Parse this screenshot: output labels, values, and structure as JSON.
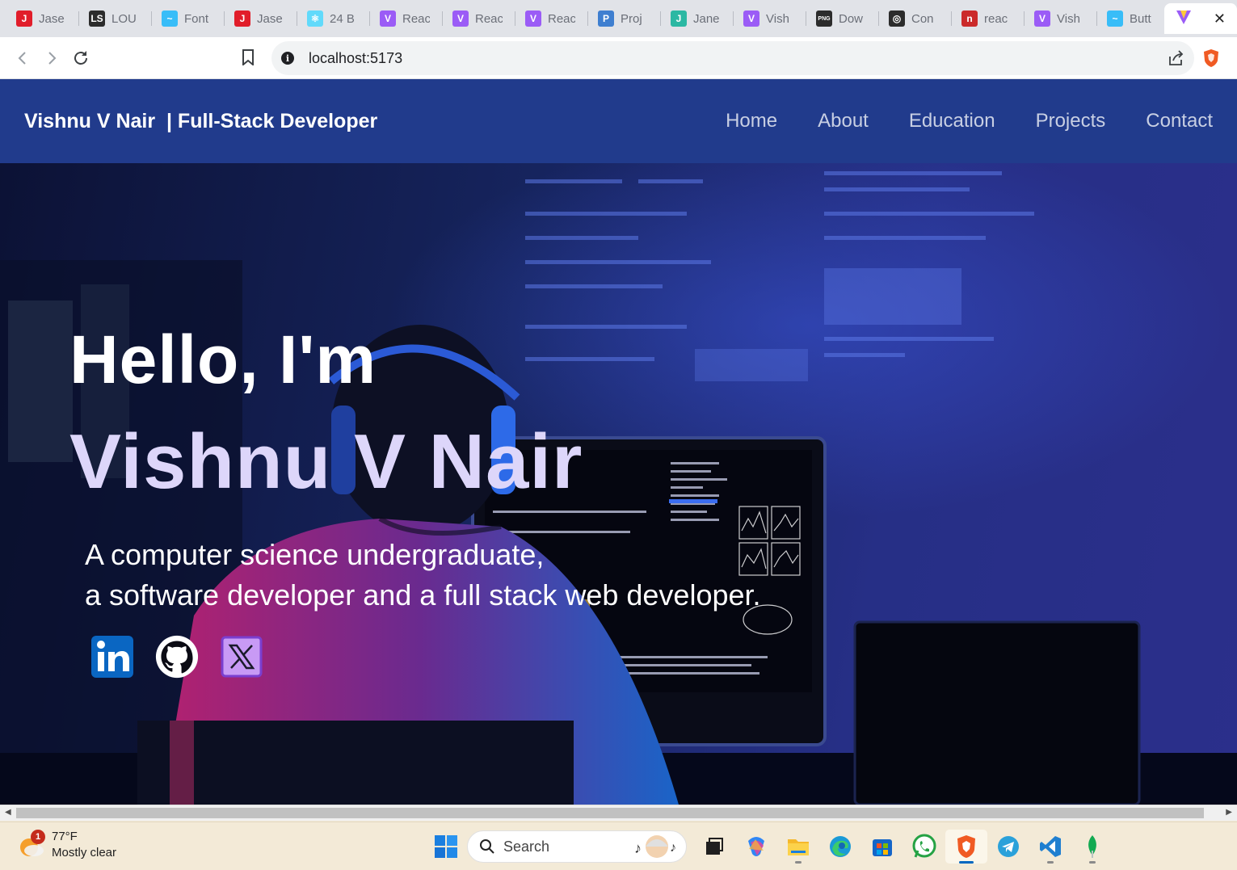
{
  "browser": {
    "tabs": [
      {
        "label": "Jase",
        "icon": "letter-j-icon",
        "color": "#e11d2a",
        "glyph": "J"
      },
      {
        "label": "LOU",
        "icon": "ls-icon",
        "color": "#2c2c2c",
        "glyph": "LS"
      },
      {
        "label": "Font",
        "icon": "tailwind-icon",
        "color": "#38bdf8",
        "glyph": "~"
      },
      {
        "label": "Jase",
        "icon": "letter-j-icon",
        "color": "#e11d2a",
        "glyph": "J"
      },
      {
        "label": "24 B",
        "icon": "react-icon",
        "color": "#61dafb",
        "glyph": "⚛"
      },
      {
        "label": "Reac",
        "icon": "vite-icon",
        "color": "#9b5cf6",
        "glyph": "V"
      },
      {
        "label": "Reac",
        "icon": "vite-icon",
        "color": "#9b5cf6",
        "glyph": "V"
      },
      {
        "label": "Reac",
        "icon": "vite-icon",
        "color": "#9b5cf6",
        "glyph": "V"
      },
      {
        "label": "Proj",
        "icon": "project-icon",
        "color": "#3f7fd0",
        "glyph": "P"
      },
      {
        "label": "Jane",
        "icon": "jane-icon",
        "color": "#2bb8a3",
        "glyph": "J"
      },
      {
        "label": "Vish",
        "icon": "vite-icon",
        "color": "#9b5cf6",
        "glyph": "V"
      },
      {
        "label": "Dow",
        "icon": "png-icon",
        "color": "#2c2c2c",
        "glyph": "PNG"
      },
      {
        "label": "Con",
        "icon": "chatgpt-icon",
        "color": "#2c2c2c",
        "glyph": "◎"
      },
      {
        "label": "reac",
        "icon": "npm-icon",
        "color": "#cb2a2a",
        "glyph": "n"
      },
      {
        "label": "Vish",
        "icon": "vite-icon",
        "color": "#9b5cf6",
        "glyph": "V"
      },
      {
        "label": "Butt",
        "icon": "tailwind-icon",
        "color": "#38bdf8",
        "glyph": "~"
      }
    ],
    "active_tab": {
      "icon": "vite-icon",
      "close_glyph": "✕"
    },
    "url": "localhost:5173"
  },
  "site": {
    "brand": "Vishnu V Nair  | Full-Stack Developer",
    "nav": [
      "Home",
      "About",
      "Education",
      "Projects",
      "Contact"
    ],
    "hero": {
      "hello": "Hello, I'm",
      "name": "Vishnu V Nair",
      "tagline_line1": "A computer science undergraduate,",
      "tagline_line2": "a software developer and a full stack web developer."
    },
    "socials": [
      "linkedin-icon",
      "github-icon",
      "x-twitter-icon"
    ]
  },
  "taskbar": {
    "weather": {
      "temp": "77°F",
      "condition": "Mostly clear",
      "badge": "1"
    },
    "search_label": "Search",
    "apps": [
      "windows-start-icon",
      "task-view-icon",
      "copilot-icon",
      "file-explorer-icon",
      "edge-icon",
      "store-icon",
      "whatsapp-icon",
      "brave-icon",
      "telegram-icon",
      "vscode-icon",
      "mongodb-icon"
    ]
  },
  "colors": {
    "header_bg": "#213b8c",
    "name_color": "#ddd6fa",
    "nav_color": "#c8cfe3"
  }
}
